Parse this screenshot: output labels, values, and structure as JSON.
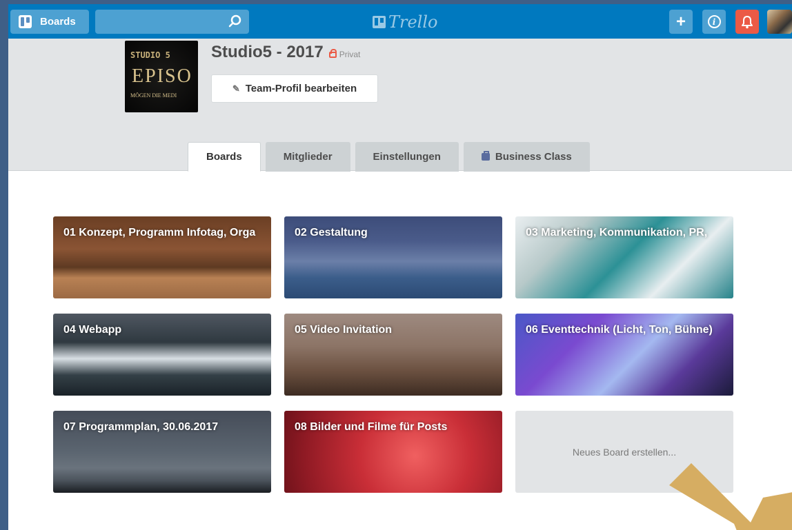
{
  "topbar": {
    "boards_label": "Boards",
    "search_placeholder": "",
    "logo_text": "Trello",
    "add_symbol": "+",
    "info_symbol": "i"
  },
  "team": {
    "name": "Studio5 - 2017",
    "privacy": "Privat",
    "edit_label": "Team-Profil bearbeiten",
    "logo_text": {
      "line1": "STUDIO 5",
      "line2": "EPISO",
      "line3": "MÖGEN DIE MEDI"
    }
  },
  "tabs": [
    {
      "label": "Boards",
      "active": true
    },
    {
      "label": "Mitglieder",
      "active": false
    },
    {
      "label": "Einstellungen",
      "active": false
    },
    {
      "label": "Business Class",
      "active": false
    }
  ],
  "boards": [
    {
      "title": "01 Konzept, Programm Infotag, Orga"
    },
    {
      "title": "02 Gestaltung"
    },
    {
      "title": "03 Marketing, Kommunikation, PR,"
    },
    {
      "title": "04 Webapp"
    },
    {
      "title": "05 Video Invitation"
    },
    {
      "title": "06 Eventtechnik (Licht, Ton, Bühne)"
    },
    {
      "title": "07 Programmplan, 30.06.2017"
    },
    {
      "title": "08 Bilder und Filme für Posts"
    }
  ],
  "new_board_label": "Neues Board erstellen...",
  "colors": {
    "topbar": "#0079bf",
    "header_bg": "#e2e4e6",
    "notification": "#eb5a46",
    "arrow": "#d6ad62"
  },
  "icons": {
    "boards": "boards-icon",
    "search": "search-icon",
    "add": "plus-icon",
    "info": "info-icon",
    "notification": "bell-icon",
    "privacy": "lock-icon",
    "edit": "pencil-icon",
    "business_class": "briefcase-icon",
    "pointer": "arrow-icon"
  }
}
